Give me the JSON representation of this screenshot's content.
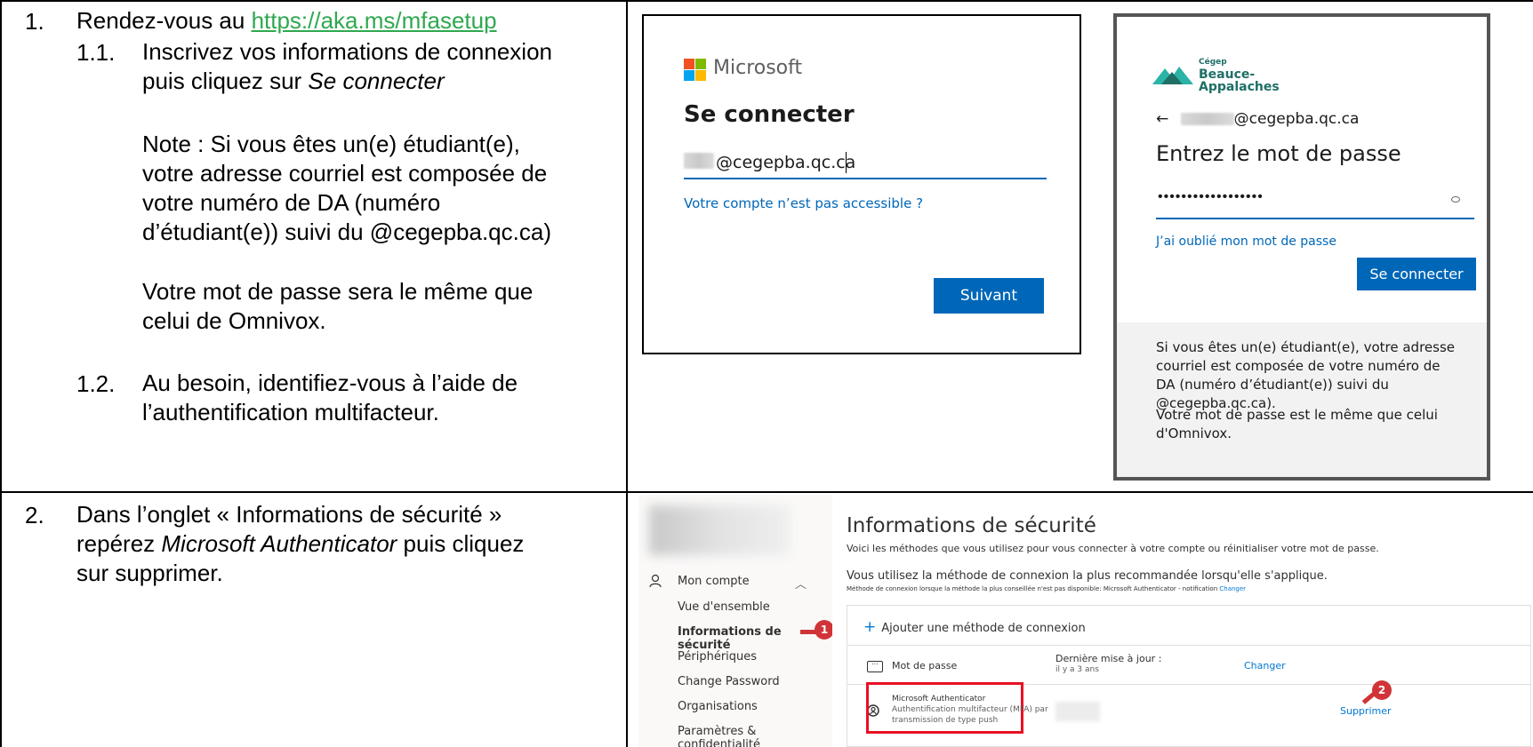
{
  "step1": {
    "number": "1.",
    "intro": "Rendez-vous au ",
    "url": "https://aka.ms/mfasetup",
    "sub1_number": "1.1.",
    "sub1_line1": "Inscrivez vos informations de connexion",
    "sub1_line2_prefix": "puis cliquez sur ",
    "sub1_line2_italic": "Se connecter",
    "note_lines": [
      "Note : Si vous êtes un(e) étudiant(e),",
      "votre adresse courriel est composée de",
      "votre numéro de DA (numéro",
      "d’étudiant(e)) suivi du @cegepba.qc.ca)"
    ],
    "password_lines": [
      "Votre mot de passe sera le même que",
      "celui de Omnivox."
    ],
    "sub2_number": "1.2.",
    "sub2_lines": [
      "Au besoin, identifiez-vous à l’aide de",
      "l’authentification multifacteur."
    ]
  },
  "step2": {
    "number": "2.",
    "line1": "Dans l’onglet « Informations de sécurité »",
    "line2_prefix": "repérez ",
    "line2_italic": "Microsoft Authenticator",
    "line2_suffix": " puis cliquez",
    "line3": "sur supprimer."
  },
  "microsoft_signin": {
    "brand": "Microsoft",
    "title": "Se connecter",
    "email_value": "@cegepba.qc.ca",
    "link": "Votre compte n’est pas accessible ?",
    "button": "Suivant"
  },
  "cegep_password": {
    "logo_small": "Cégep",
    "logo_line1": "Beauce-",
    "logo_line2": "Appalaches",
    "back_arrow": "←",
    "email": "@cegepba.qc.ca",
    "title": "Entrez le mot de passe",
    "password_dots": "••••••••••••••••••",
    "forgot_link": "J’ai oublié mon mot de passe",
    "button": "Se connecter",
    "footer_para1": "Si vous êtes un(e) étudiant(e), votre adresse courriel est composée de votre numéro de DA (numéro d’étudiant(e)) suivi du @cegepba.qc.ca).",
    "footer_para2": "Votre mot de passe est le même que celui d'Omnivox."
  },
  "security_info": {
    "nav": {
      "account": "Mon compte",
      "items": [
        "Vue d'ensemble",
        "Informations de sécurité",
        "Périphériques",
        "Change Password",
        "Organisations",
        "Paramètres & confidentialité"
      ]
    },
    "badge1": "1",
    "badge2": "2",
    "title": "Informations de sécurité",
    "subtitle": "Voici les méthodes que vous utilisez pour vous connecter à votre compte ou réinitialiser votre mot de passe.",
    "recommended": "Vous utilisez la méthode de connexion la plus recommandée lorsqu'elle s'applique.",
    "fine_print": "Méthode de connexion lorsque la méthode la plus conseillée n'est pas disponible: Microsoft Authenticator - notification",
    "fine_link": "Changer",
    "add_method": "Ajouter une méthode de connexion",
    "password_row": {
      "label": "Mot de passe",
      "last_update": "Dernière mise à jour :",
      "ago": "il y a 3 ans",
      "action": "Changer"
    },
    "auth_row": {
      "name": "Microsoft Authenticator",
      "desc_line1": "Authentification multifacteur (MFA) par",
      "desc_line2": "transmission de type push",
      "action": "Supprimer"
    },
    "colors": {
      "accent": "#0078d4",
      "highlight": "#e81123",
      "badge": "#d13438"
    }
  }
}
